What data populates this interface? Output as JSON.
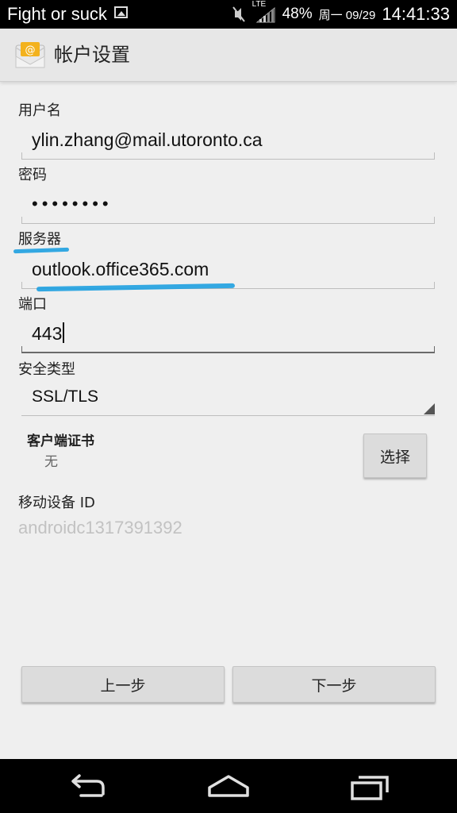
{
  "statusbar": {
    "notification_text": "Fight or suck",
    "network": "LTE",
    "battery": "48%",
    "date": "周一 09/29",
    "time": "14:41:33"
  },
  "actionbar": {
    "title": "帐户设置"
  },
  "form": {
    "username_label": "用户名",
    "username_value": "ylin.zhang@mail.utoronto.ca",
    "password_label": "密码",
    "password_value": "••••••••",
    "server_label": "服务器",
    "server_value": "outlook.office365.com",
    "port_label": "端口",
    "port_value": "443",
    "security_label": "安全类型",
    "security_value": "SSL/TLS",
    "client_cert_label": "客户端证书",
    "client_cert_value": "无",
    "choose_button": "选择",
    "device_id_label": "移动设备 ID",
    "device_id_value": "androidc1317391392"
  },
  "buttons": {
    "previous": "上一步",
    "next": "下一步"
  },
  "colors": {
    "highlight": "#1ea0e0"
  },
  "icons": {
    "app": "email-icon",
    "back": "back-icon",
    "home": "home-icon",
    "recents": "recents-icon"
  }
}
